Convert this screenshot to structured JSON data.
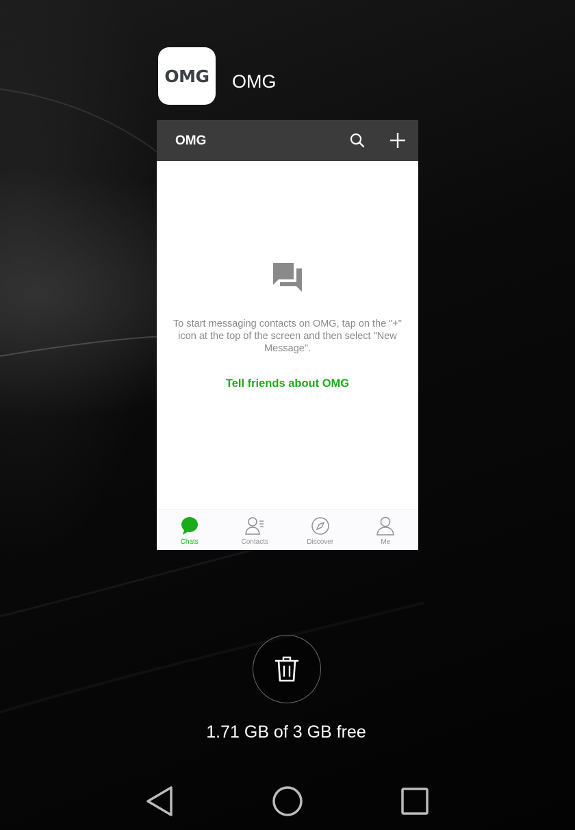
{
  "recent_app": {
    "icon_text": "OMG",
    "name": "OMG"
  },
  "thumbnail": {
    "title": "OMG",
    "topbar_icons": [
      "search-icon",
      "plus-icon"
    ],
    "empty_icon": "chat-bubbles-icon",
    "empty_message": "To start messaging contacts on OMG, tap on the \"+\" icon at the top of the screen and then select \"New Message\".",
    "tell_friends_link": "Tell friends about OMG",
    "bottom_tabs": [
      {
        "label": "Chats",
        "icon": "chat-bubble-icon",
        "active": true
      },
      {
        "label": "Contacts",
        "icon": "contacts-icon",
        "active": false
      },
      {
        "label": "Discover",
        "icon": "compass-icon",
        "active": false
      },
      {
        "label": "Me",
        "icon": "person-icon",
        "active": false
      }
    ],
    "accent_color": "#1aad19",
    "topbar_color": "#3b3b3b"
  },
  "clear_all": {
    "icon": "trash-icon"
  },
  "memory_status": "1.71 GB of 3 GB free",
  "system_nav": {
    "icons": [
      "back-icon",
      "home-icon",
      "recents-icon"
    ]
  }
}
